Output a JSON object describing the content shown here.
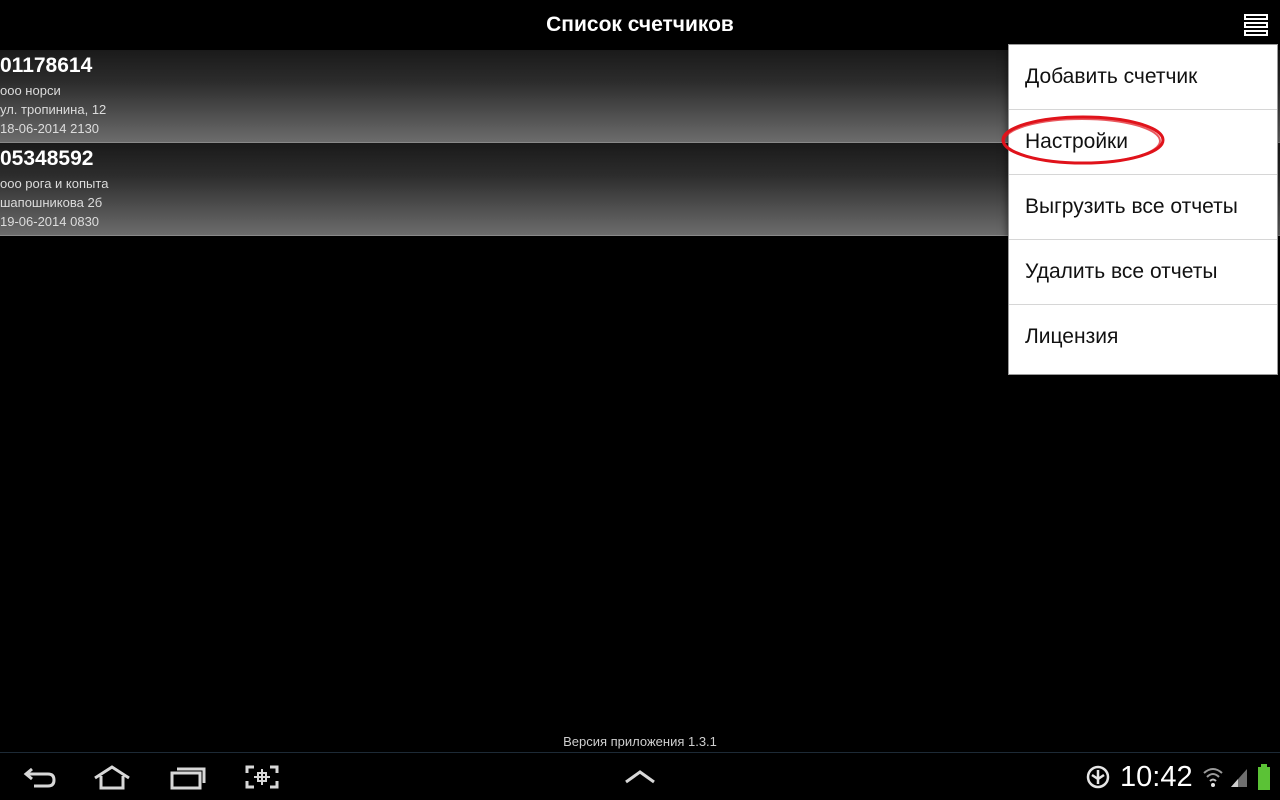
{
  "app": {
    "title": "Список счетчиков"
  },
  "counters": [
    {
      "number": "01178614",
      "company": "ооо норси",
      "address": "ул. тропинина, 12",
      "datetime": "18-06-2014 2130"
    },
    {
      "number": "05348592",
      "company": "ооо рога и копыта",
      "address": "шапошникова 2б",
      "datetime": "19-06-2014 0830"
    }
  ],
  "menu": {
    "items": [
      {
        "label": "Добавить счетчик"
      },
      {
        "label": "Настройки"
      },
      {
        "label": "Выгрузить все отчеты"
      },
      {
        "label": "Удалить все отчеты"
      },
      {
        "label": "Лицензия"
      }
    ],
    "highlight_color": "#e0131b"
  },
  "footer": {
    "version": "Версия приложения 1.3.1"
  },
  "systembar": {
    "time": "10:42",
    "icons": [
      "back-icon",
      "home-icon",
      "recent-apps-icon",
      "screenshot-icon",
      "chevron-up-icon",
      "gps-icon",
      "wifi-icon",
      "signal-icon",
      "battery-icon"
    ],
    "accent": "#33b5e5",
    "battery_color": "#5bc236"
  }
}
